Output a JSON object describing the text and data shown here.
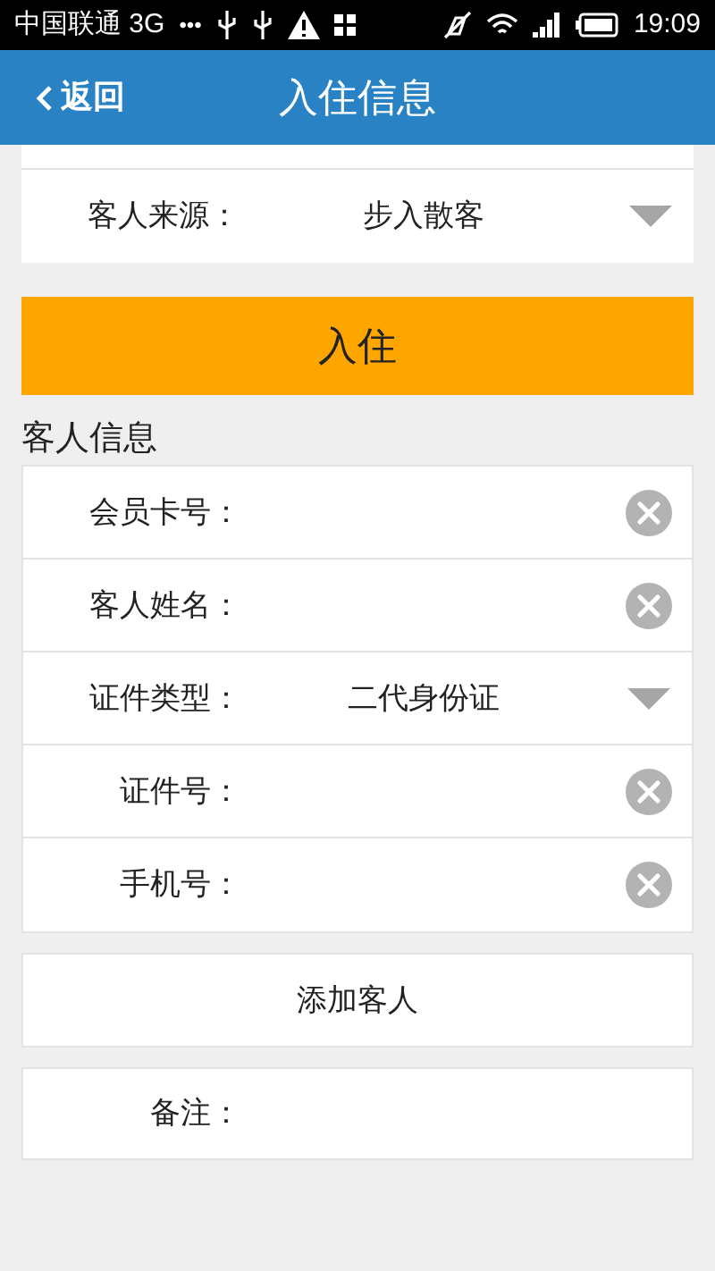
{
  "status_bar": {
    "carrier": "中国联通 3G",
    "dots": "•••",
    "time": "19:09"
  },
  "header": {
    "back": "返回",
    "title": "入住信息"
  },
  "source_row": {
    "kind": "select",
    "label": "客人来源：",
    "value": "步入散客"
  },
  "checkin_button": "入住",
  "guest_section": {
    "title": "客人信息",
    "rows": [
      {
        "kind": "input",
        "label": "会员卡号："
      },
      {
        "kind": "input",
        "label": "客人姓名："
      },
      {
        "kind": "select",
        "label": "证件类型：",
        "value": "二代身份证"
      },
      {
        "kind": "input",
        "label": "证件号："
      },
      {
        "kind": "input",
        "label": "手机号："
      }
    ]
  },
  "add_guest_button": "添加客人",
  "remarks": {
    "label": "备注："
  }
}
